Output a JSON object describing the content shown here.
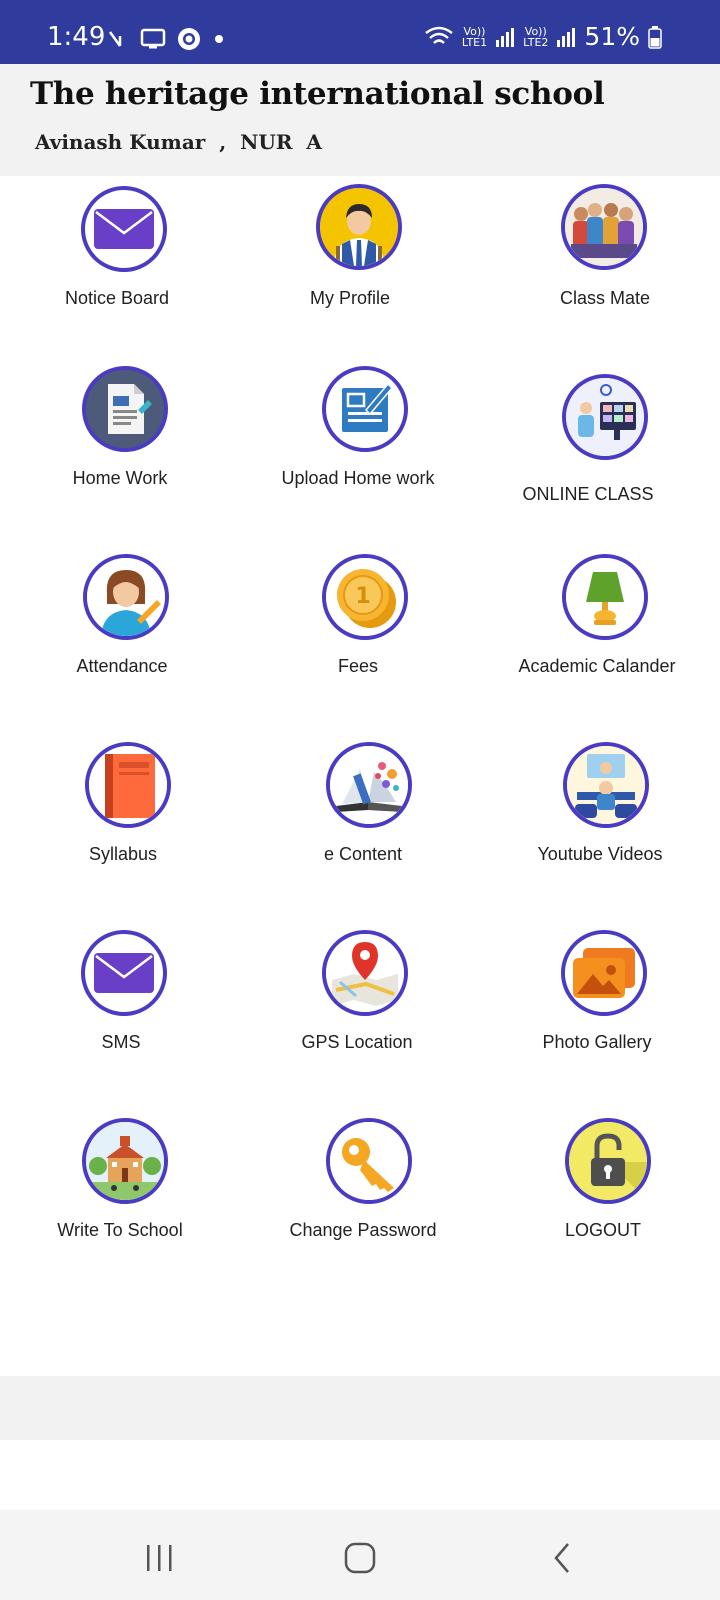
{
  "status_bar": {
    "time": "1:49",
    "battery": "51%",
    "sim1": "LTE1",
    "sim2": "LTE2",
    "volte": "Vo))"
  },
  "header": {
    "school_name": "The heritage international school",
    "student_line": "Avinash Kumar  ,  NUR  A"
  },
  "menu": [
    {
      "label": "Notice Board",
      "icon": "envelope-icon"
    },
    {
      "label": "My Profile",
      "icon": "student-avatar-icon"
    },
    {
      "label": "Class Mate",
      "icon": "classmates-group-icon"
    },
    {
      "label": "Home Work",
      "icon": "homework-document-icon"
    },
    {
      "label": "Upload Home work",
      "icon": "upload-homework-icon"
    },
    {
      "label": "ONLINE CLASS",
      "icon": "online-class-icon"
    },
    {
      "label": "Attendance",
      "icon": "attendance-teacher-icon"
    },
    {
      "label": "Fees",
      "icon": "coin-icon"
    },
    {
      "label": "Academic Calander",
      "icon": "lamp-icon"
    },
    {
      "label": "Syllabus",
      "icon": "book-icon"
    },
    {
      "label": "e Content",
      "icon": "econtent-book-icon"
    },
    {
      "label": "Youtube Videos",
      "icon": "video-learning-icon"
    },
    {
      "label": "SMS",
      "icon": "sms-envelope-icon"
    },
    {
      "label": "GPS Location",
      "icon": "map-pin-icon"
    },
    {
      "label": "Photo Gallery",
      "icon": "photo-gallery-icon"
    },
    {
      "label": "Write To School",
      "icon": "school-building-icon"
    },
    {
      "label": "Change Password",
      "icon": "key-icon"
    },
    {
      "label": "LOGOUT",
      "icon": "padlock-open-icon"
    }
  ],
  "colors": {
    "status_bar": "#2f3c9d",
    "icon_ring": "#4a3bc3",
    "header_bg": "#f2f2f2"
  }
}
